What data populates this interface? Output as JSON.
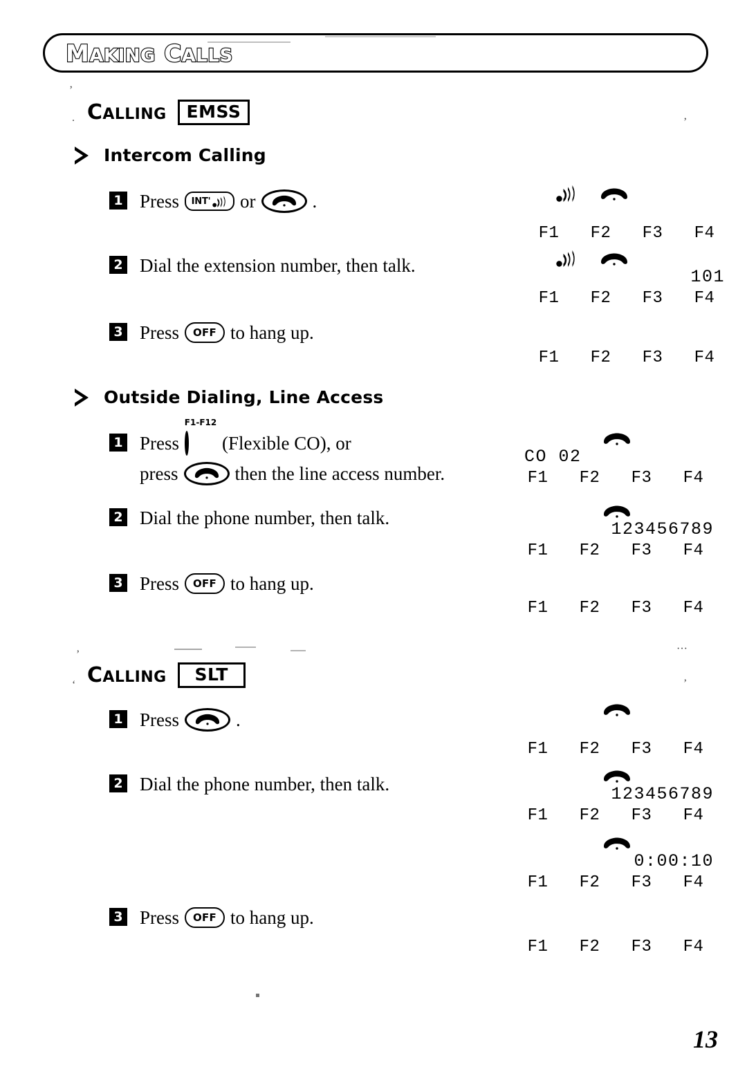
{
  "banner": {
    "title_lead": "M",
    "title_rest_1": "AKING",
    "title_lead2": "C",
    "title_rest_2": "ALLS",
    "title_full": "MAKING CALLS"
  },
  "page": {
    "number": "13"
  },
  "sections": [
    {
      "id": "calling-emss",
      "calling_word_cap": "C",
      "calling_word_rest": "ALLING",
      "tag": "EMSS",
      "subsections": [
        {
          "id": "intercom-calling",
          "heading": "Intercom Calling",
          "steps": [
            {
              "num": "1",
              "lines": [
                {
                  "before": "Press",
                  "key": "INT'",
                  "key_type": "int",
                  "middle": "or",
                  "key2_type": "handset",
                  "after": "."
                }
              ]
            },
            {
              "num": "2",
              "lines": [
                {
                  "text": "Dial the extension number, then talk."
                }
              ]
            },
            {
              "num": "3",
              "lines": [
                {
                  "before": "Press",
                  "key": "OFF",
                  "key_type": "off",
                  "after": "to hang up."
                }
              ]
            }
          ],
          "displays": [
            {
              "icons": [
                "signal",
                "handset"
              ],
              "value": "",
              "value_align": "right",
              "fkeys": [
                "F1",
                "F2",
                "F3",
                "F4"
              ]
            },
            {
              "icons": [
                "signal",
                "handset"
              ],
              "value": "101",
              "value_align": "right",
              "fkeys": [
                "F1",
                "F2",
                "F3",
                "F4"
              ]
            },
            {
              "icons": [],
              "value": "",
              "value_align": "right",
              "fkeys": [
                "F1",
                "F2",
                "F3",
                "F4"
              ]
            }
          ]
        },
        {
          "id": "outside-dialing",
          "heading": "Outside Dialing, Line Access",
          "steps": [
            {
              "num": "1",
              "lines": [
                {
                  "before": "Press",
                  "key_type": "co",
                  "key_sup": "F1-F12",
                  "after": "(Flexible CO), or"
                },
                {
                  "before": "press",
                  "key2_type": "handset",
                  "after": "then the line access number."
                }
              ]
            },
            {
              "num": "2",
              "lines": [
                {
                  "text": "Dial the phone number, then talk."
                }
              ]
            },
            {
              "num": "3",
              "lines": [
                {
                  "before": "Press",
                  "key": "OFF",
                  "key_type": "off",
                  "after": "to hang up."
                }
              ]
            }
          ],
          "displays": [
            {
              "icons": [
                "handset-center"
              ],
              "value": "CO 02",
              "value_align": "left",
              "fkeys": [
                "F1",
                "F2",
                "F3",
                "F4"
              ]
            },
            {
              "icons": [
                "handset-center"
              ],
              "value": "123456789",
              "value_align": "right",
              "fkeys": [
                "F1",
                "F2",
                "F3",
                "F4"
              ]
            },
            {
              "icons": [],
              "value": "",
              "value_align": "right",
              "fkeys": [
                "F1",
                "F2",
                "F3",
                "F4"
              ]
            }
          ]
        }
      ]
    },
    {
      "id": "calling-slt",
      "calling_word_cap": "C",
      "calling_word_rest": "ALLING",
      "tag": "SLT",
      "subsections": [
        {
          "id": "slt-steps",
          "heading": "",
          "steps": [
            {
              "num": "1",
              "lines": [
                {
                  "before": "Press",
                  "key2_type": "handset",
                  "after": "."
                }
              ]
            },
            {
              "num": "2",
              "lines": [
                {
                  "text": "Dial the phone number, then talk."
                }
              ]
            },
            {
              "num": "3",
              "lines": [
                {
                  "before": "Press",
                  "key": "OFF",
                  "key_type": "off",
                  "after": "to hang up."
                }
              ]
            }
          ],
          "displays": [
            {
              "icons": [
                "handset-center"
              ],
              "value": "",
              "value_align": "right",
              "fkeys": [
                "F1",
                "F2",
                "F3",
                "F4"
              ]
            },
            {
              "icons": [
                "handset-center"
              ],
              "value": "123456789",
              "value_align": "right",
              "fkeys": [
                "F1",
                "F2",
                "F3",
                "F4"
              ]
            },
            {
              "icons": [
                "handset-center"
              ],
              "value": "0:00:10",
              "value_align": "right",
              "fkeys": [
                "F1",
                "F2",
                "F3",
                "F4"
              ]
            },
            {
              "icons": [],
              "value": "",
              "value_align": "right",
              "fkeys": [
                "F1",
                "F2",
                "F3",
                "F4"
              ]
            }
          ]
        }
      ]
    }
  ],
  "labels": {
    "press": "Press",
    "press_lower": "press",
    "or": "or",
    "off_key": "OFF",
    "int_key": "INT'",
    "co_sup": "F1-F12",
    "flexible_co": "(Flexible CO), or",
    "line_access_tail": "then the line access number.",
    "hang_up_tail": "to hang up.",
    "dial_extension": "Dial the extension number, then talk.",
    "dial_phone": "Dial the phone number, then talk.",
    "period": ".",
    "intercom_heading": "Intercom Calling",
    "outside_heading": "Outside Dialing, Line Access",
    "emss_tag": "EMSS",
    "slt_tag": "SLT",
    "f1": "F1",
    "f2": "F2",
    "f3": "F3",
    "f4": "F4",
    "ext_101": "101",
    "co_02": "CO 02",
    "num_123456789": "123456789",
    "timer": "0:00:10"
  },
  "colors": {
    "ink": "#000000",
    "paper": "#ffffff"
  }
}
